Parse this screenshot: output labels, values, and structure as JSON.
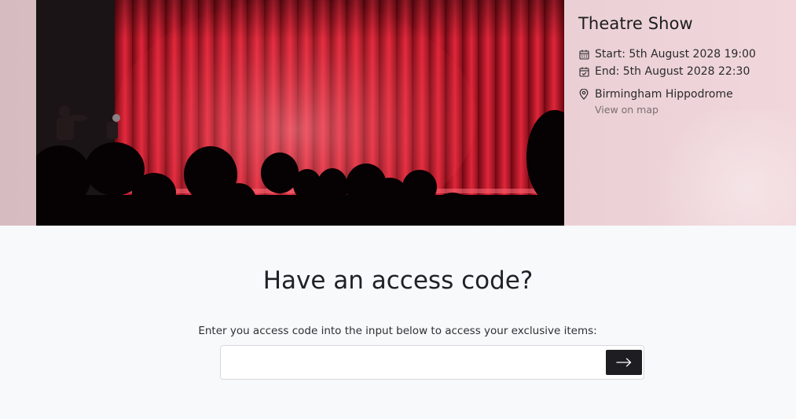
{
  "event": {
    "title": "Theatre Show",
    "start": "Start: 5th August 2028 19:00",
    "end": "End: 5th August 2028 22:30",
    "venue": "Birmingham Hippodrome",
    "map_link": "View on map",
    "image_subject": "stage-curtain-photo"
  },
  "icons": {
    "start": "calendar-icon",
    "end": "calendar-check-icon",
    "venue": "location-pin-icon",
    "submit": "arrow-right-icon"
  },
  "access": {
    "heading": "Have an access code?",
    "description": "Enter you access code into the input below to access your exclusive items:",
    "input_value": "",
    "input_placeholder": ""
  },
  "colors": {
    "hero_bg": "#e2c8cc",
    "page_bg": "#f8f9fb",
    "button_bg": "#1e1e22",
    "text_primary": "#212126",
    "link_muted": "#7a6e71"
  }
}
